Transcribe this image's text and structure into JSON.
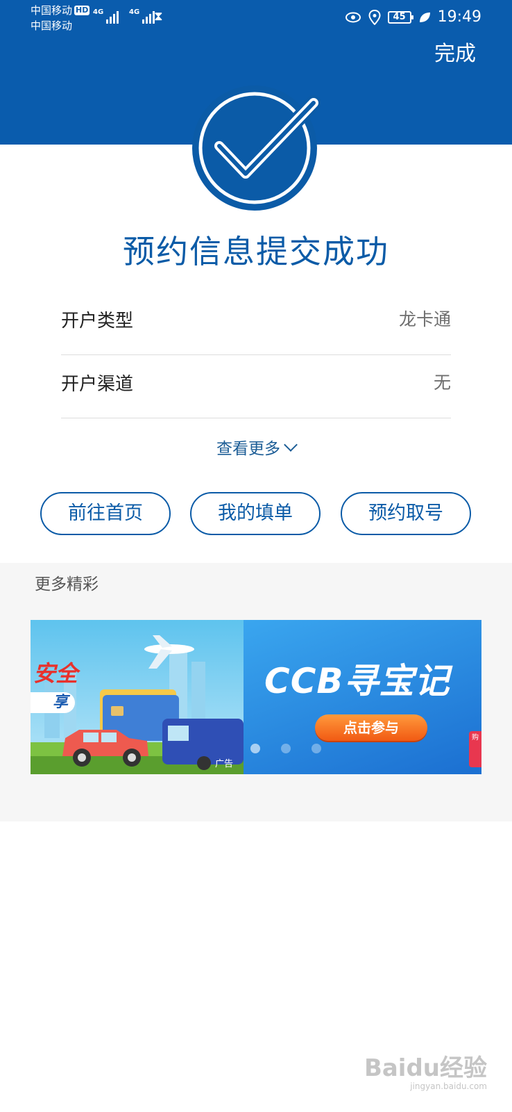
{
  "status_bar": {
    "carrier_1": "中国移动",
    "carrier_2": "中国移动",
    "hd": "HD",
    "network_1": "4G",
    "network_2": "4G",
    "battery": "45",
    "time": "19:49",
    "icons": [
      "eye-icon",
      "location-icon",
      "leaf-icon",
      "hourglass-icon",
      "signal-icon"
    ]
  },
  "header": {
    "done_label": "完成",
    "bg_color": "#0a5cad"
  },
  "success": {
    "title": "预约信息提交成功",
    "icon": "check-circle-icon"
  },
  "info": {
    "rows": [
      {
        "label": "开户类型",
        "value": "龙卡通"
      },
      {
        "label": "开户渠道",
        "value": "无"
      }
    ],
    "see_more": "查看更多"
  },
  "actions": {
    "home": "前往首页",
    "my_forms": "我的填单",
    "ticket": "预约取号"
  },
  "more": {
    "title": "更多精彩",
    "banner": {
      "left_text_safe": "安全",
      "left_text_share": "享",
      "right_title": "CCB寻宝记",
      "join_label": "点击参与",
      "ad_label": "广告",
      "side_badge": "购",
      "dots_count": 3
    }
  },
  "watermark": {
    "main": "Baidu经验",
    "sub": "jingyan.baidu.com"
  }
}
